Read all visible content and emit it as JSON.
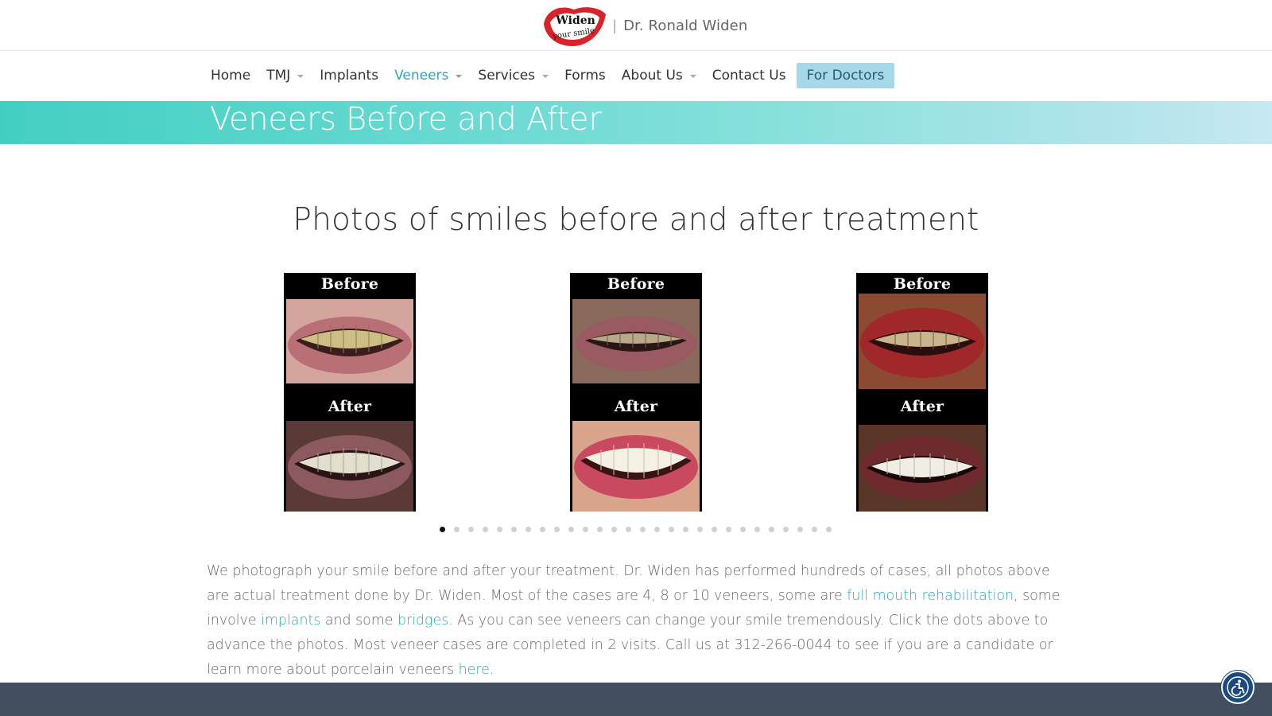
{
  "header": {
    "logo_text_top": "Widen",
    "logo_text_bottom": "your smile",
    "separator": "|",
    "doctor_name": "Dr. Ronald Widen"
  },
  "nav": {
    "items": [
      {
        "label": "Home",
        "has_dropdown": false,
        "active": false
      },
      {
        "label": "TMJ",
        "has_dropdown": true,
        "active": false
      },
      {
        "label": "Implants",
        "has_dropdown": false,
        "active": false
      },
      {
        "label": "Veneers",
        "has_dropdown": true,
        "active": true
      },
      {
        "label": "Services",
        "has_dropdown": true,
        "active": false
      },
      {
        "label": "Forms",
        "has_dropdown": false,
        "active": false
      },
      {
        "label": "About Us",
        "has_dropdown": true,
        "active": false
      },
      {
        "label": "Contact Us",
        "has_dropdown": false,
        "active": false
      },
      {
        "label": "For Doctors",
        "has_dropdown": false,
        "active": false,
        "highlight": true
      }
    ]
  },
  "banner": {
    "title": "Veneers Before and After"
  },
  "gallery": {
    "heading": "Photos of smiles before and after treatment",
    "slides": [
      {
        "before_label": "Before",
        "after_label": "After"
      },
      {
        "before_label": "Before",
        "after_label": "After"
      },
      {
        "before_label": "Before",
        "after_label": "After"
      }
    ],
    "dot_count": 28,
    "active_dot": 1
  },
  "copy": {
    "part1": "We photograph your smile before and after your treatment. Dr. Widen has performed hundreds of cases, all photos above are actual treatment done by Dr. Widen. Most of the cases are 4, 8 or 10 veneers, some are ",
    "link1": "full mouth rehabilitation",
    "part2": ", some involve ",
    "link2": "implants",
    "part3": " and some ",
    "link3": "bridges",
    "part4": ". As you can see veneers can change your smile tremendously. Click the dots above to advance the photos. Most veneer cases are completed in 2 visits.  Call us at 312-266-0044 to see if you are a candidate or learn more about porcelain veneers ",
    "link4": "here",
    "part5": "."
  },
  "colors": {
    "accent": "#2ea3c6",
    "banner_start": "#43cfc0",
    "banner_end": "#c8e8f2",
    "footer": "#434f5f",
    "a11y_button": "#1c4a7e"
  },
  "icons": {
    "accessibility": "accessibility-icon"
  }
}
